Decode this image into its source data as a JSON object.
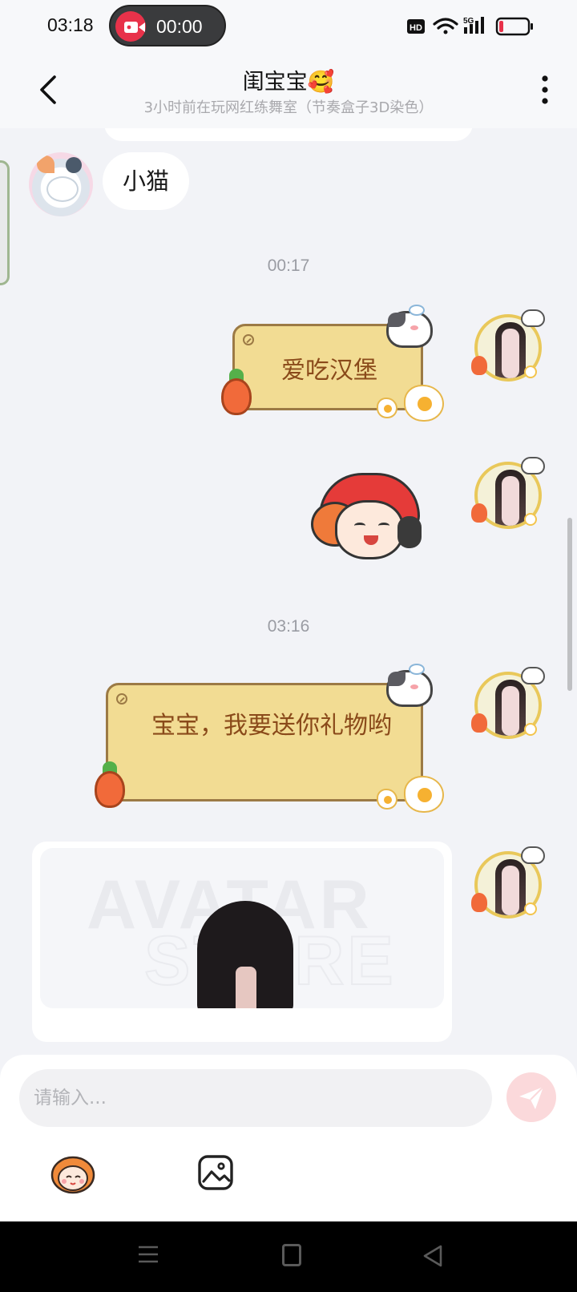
{
  "status_bar": {
    "time": "03:18",
    "recording_time": "00:00",
    "icons": [
      "hd-icon",
      "wifi-icon",
      "5g-signal-icon",
      "battery-low-icon"
    ]
  },
  "header": {
    "title": "闺宝宝🥰",
    "subtitle": "3小时前在玩网红练舞室（节奏盒子3D染色）"
  },
  "messages": [
    {
      "side": "left",
      "type": "text",
      "text": "小猫"
    },
    {
      "type": "time",
      "text": "00:17"
    },
    {
      "side": "right",
      "type": "card",
      "text": "爱吃汉堡"
    },
    {
      "side": "right",
      "type": "sticker"
    },
    {
      "type": "time",
      "text": "03:16"
    },
    {
      "side": "right",
      "type": "card",
      "text": "宝宝，我要送你礼物哟"
    },
    {
      "side": "right",
      "type": "store-card",
      "watermark_top": "AVATAR",
      "watermark_bottom": "STORE"
    }
  ],
  "composer": {
    "placeholder": "请输入..."
  },
  "colors": {
    "background": "#f2f3f7",
    "card_fill": "#f2dc93",
    "card_text": "#8a4a1a",
    "recording": "#e8324a",
    "send_button": "#fbd9db"
  }
}
